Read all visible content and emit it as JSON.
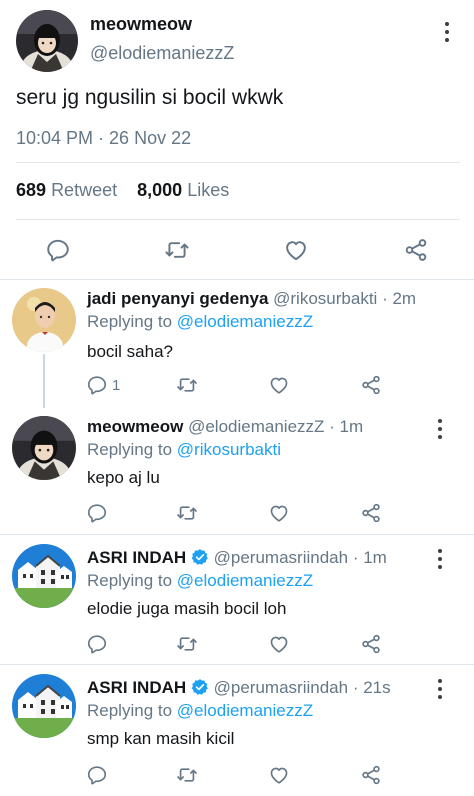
{
  "main_tweet": {
    "name": "meowmeow",
    "handle": "@elodiemaniezzZ",
    "text": "seru jg ngusilin si bocil wkwk",
    "timestamp": "10:04 PM · 26 Nov 22",
    "retweets": "689",
    "retweets_label": "Retweet",
    "likes": "8,000",
    "likes_label": "Likes"
  },
  "replies": [
    {
      "name": "jadi penyanyi gedenya",
      "handle": "@rikosurbakti",
      "time": "· 2m",
      "replying_label": "Replying to",
      "replying_to": "@elodiemaniezzZ",
      "text": "bocil saha?",
      "reply_count": "1"
    },
    {
      "name": "meowmeow",
      "handle": "@elodiemaniezzZ",
      "time": "· 1m",
      "replying_label": "Replying to",
      "replying_to": "@rikosurbakti",
      "text": "kepo aj lu",
      "reply_count": ""
    },
    {
      "name": "ASRI INDAH",
      "handle": "@perumasriindah",
      "time": "· 1m",
      "replying_label": "Replying to",
      "replying_to": "@elodiemaniezzZ",
      "text": "elodie juga masih bocil loh",
      "reply_count": ""
    },
    {
      "name": "ASRI INDAH",
      "handle": "@perumasriindah",
      "time": "· 21s",
      "replying_label": "Replying to",
      "replying_to": "@elodiemaniezzZ",
      "text": "smp kan masih kicil",
      "reply_count": ""
    }
  ],
  "colors": {
    "link": "#1da1f2",
    "secondary_text": "#657786",
    "icon": "#657786",
    "divider": "#e1e8ed"
  },
  "icons": [
    "reply-icon",
    "retweet-icon",
    "like-icon",
    "share-icon",
    "more-icon",
    "verified-icon"
  ]
}
